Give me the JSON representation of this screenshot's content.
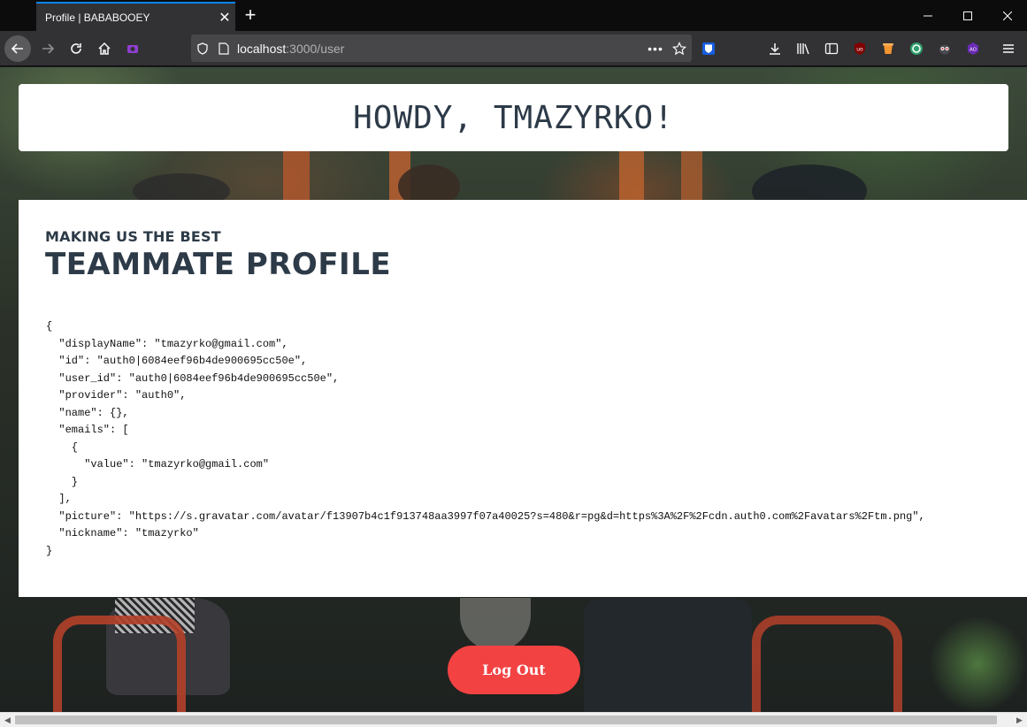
{
  "browser": {
    "tab_title": "Profile | BABABOOEY",
    "url_host": "localhost",
    "url_path": ":3000/user"
  },
  "page": {
    "greeting": "HOWDY, TMAZYRKO!",
    "kicker": "MAKING US THE BEST",
    "title": "TEAMMATE PROFILE",
    "json_lines": [
      "{",
      "  \"displayName\": \"tmazyrko@gmail.com\",",
      "  \"id\": \"auth0|6084eef96b4de900695cc50e\",",
      "  \"user_id\": \"auth0|6084eef96b4de900695cc50e\",",
      "  \"provider\": \"auth0\",",
      "  \"name\": {},",
      "  \"emails\": [",
      "    {",
      "      \"value\": \"tmazyrko@gmail.com\"",
      "    }",
      "  ],",
      "  \"picture\": \"https://s.gravatar.com/avatar/f13907b4c1f913748aa3997f07a40025?s=480&r=pg&d=https%3A%2F%2Fcdn.auth0.com%2Favatars%2Ftm.png\",",
      "  \"nickname\": \"tmazyrko\"",
      "}"
    ],
    "logout_label": "Log Out"
  },
  "colors": {
    "accent": "#f24242",
    "heading": "#2d3a48",
    "tab_indicator": "#0a84ff"
  }
}
